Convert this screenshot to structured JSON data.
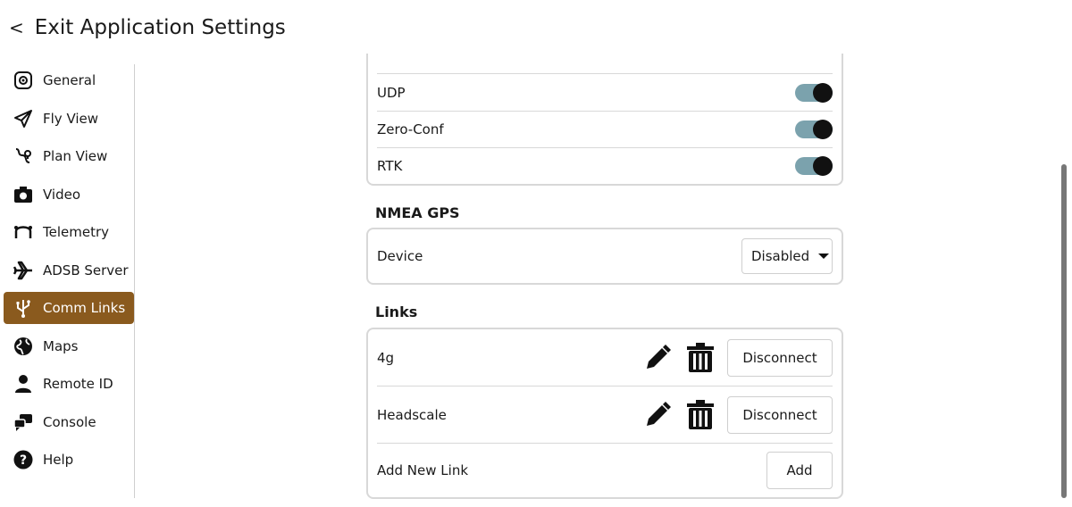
{
  "header": {
    "back_glyph": "<",
    "title": "Exit Application Settings"
  },
  "sidebar": {
    "items": [
      {
        "label": "General",
        "icon": "gear-icon"
      },
      {
        "label": "Fly View",
        "icon": "paper-plane-icon"
      },
      {
        "label": "Plan View",
        "icon": "route-icon"
      },
      {
        "label": "Video",
        "icon": "camera-icon"
      },
      {
        "label": "Telemetry",
        "icon": "telemetry-icon"
      },
      {
        "label": "ADSB Server",
        "icon": "airplane-icon"
      },
      {
        "label": "Comm Links",
        "icon": "usb-icon",
        "active": true
      },
      {
        "label": "Maps",
        "icon": "globe-icon"
      },
      {
        "label": "Remote ID",
        "icon": "person-icon"
      },
      {
        "label": "Console",
        "icon": "chat-icon"
      },
      {
        "label": "Help",
        "icon": "help-icon"
      }
    ],
    "active_color": "#8a5a1e"
  },
  "autoconnect": {
    "rows": [
      {
        "label": "UDP",
        "enabled": true
      },
      {
        "label": "Zero-Conf",
        "enabled": true
      },
      {
        "label": "RTK",
        "enabled": true
      }
    ],
    "toggle_color": "#7ba2ad"
  },
  "nmea": {
    "title": "NMEA GPS",
    "device_label": "Device",
    "device_value": "Disabled"
  },
  "links": {
    "title": "Links",
    "items": [
      {
        "name": "4g",
        "action": "Disconnect"
      },
      {
        "name": "Headscale",
        "action": "Disconnect"
      }
    ],
    "add_label": "Add New Link",
    "add_button": "Add"
  }
}
